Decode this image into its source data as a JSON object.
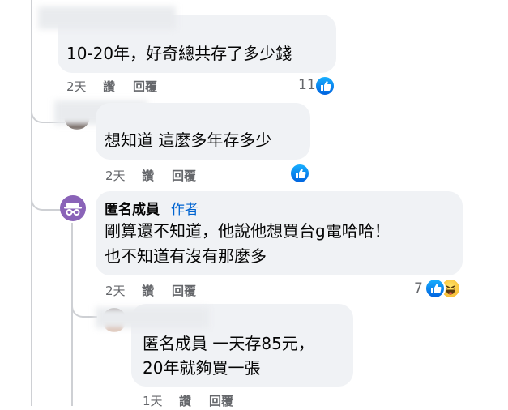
{
  "comments": [
    {
      "text": "10-20年，好奇總共存了多少錢",
      "time": "2天",
      "like_label": "讚",
      "reply_label": "回覆",
      "reaction_count": "11"
    },
    {
      "text": "想知道 這麼多年存多少",
      "time": "2天",
      "like_label": "讚",
      "reply_label": "回覆",
      "reaction_count": ""
    },
    {
      "author": "匿名成員",
      "author_badge": "作者",
      "line1": "剛算還不知道，他說他想買台g電哈哈！",
      "line2": "也不知道有沒有那麼多",
      "time": "2天",
      "like_label": "讚",
      "reply_label": "回覆",
      "reaction_count": "7"
    },
    {
      "line1": "匿名成員 一天存85元，",
      "line2": "20年就夠買一張",
      "time": "1天",
      "like_label": "讚",
      "reply_label": "回覆"
    }
  ],
  "colors": {
    "bubble": "#f0f2f5",
    "meta_text": "#65676b",
    "like_blue": "#0866ff",
    "badge_blue": "#0064d1",
    "anon_avatar": "#8a63b8"
  }
}
